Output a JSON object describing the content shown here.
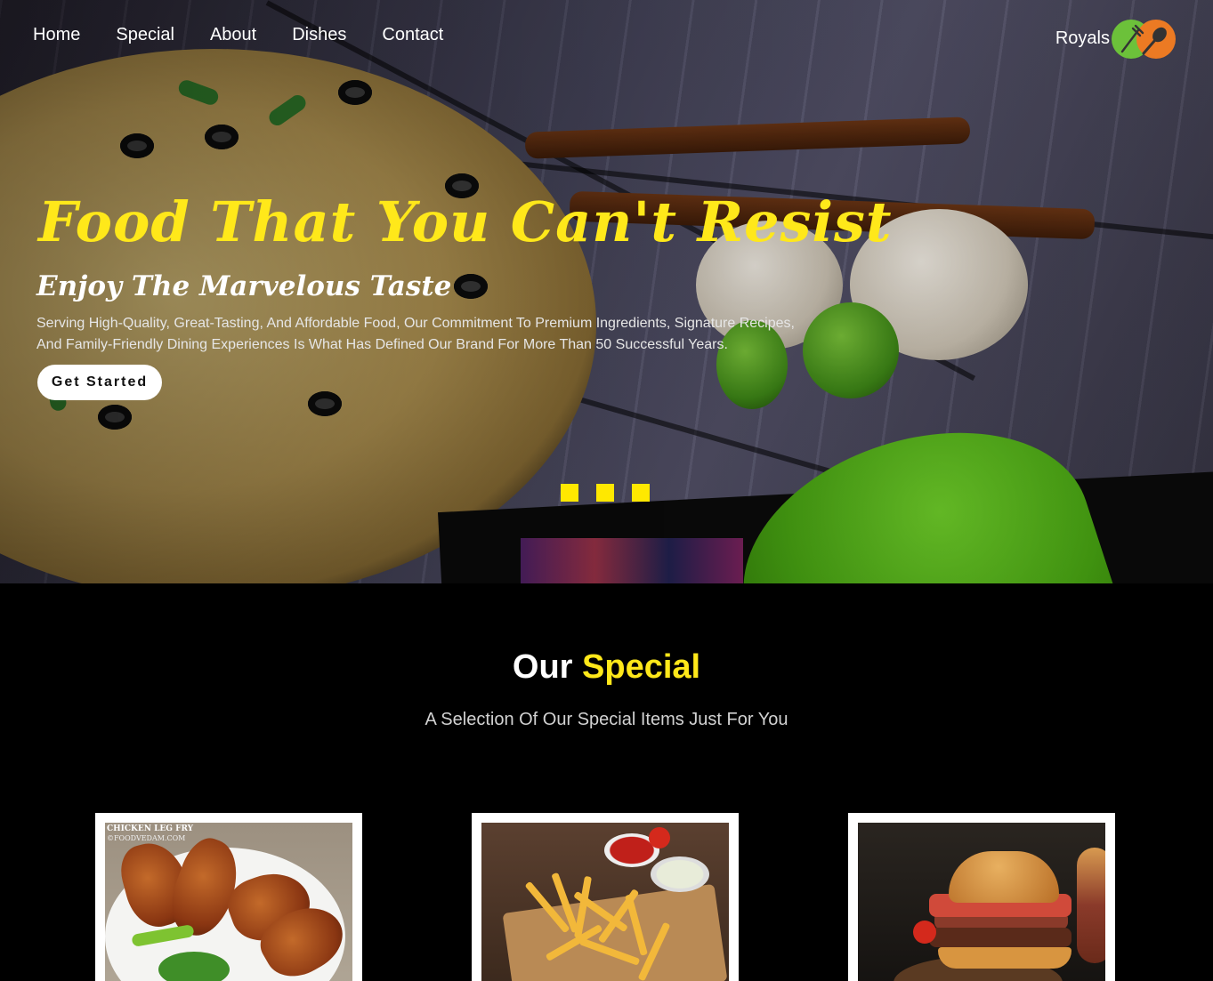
{
  "nav": {
    "items": [
      "Home",
      "Special",
      "About",
      "Dishes",
      "Contact"
    ],
    "brand": "Royals",
    "logo_icons": [
      "fork-knife-icon",
      "spoon-icon"
    ]
  },
  "hero": {
    "title": "Food That You Can't Resist",
    "subtitle": "Enjoy The Marvelous Taste",
    "description": "Serving High-Quality, Great-Tasting, And Affordable Food, Our Commitment To Premium Ingredients, Signature Recipes, And Family-Friendly Dining Experiences Is What Has Defined Our Brand For More Than 50 Successful Years.",
    "cta_label": "Get Started",
    "slide_count": 3
  },
  "special": {
    "title_part1": "Our",
    "title_part2": "Special",
    "subtitle": "A Selection Of Our Special Items Just For You",
    "cards": [
      {
        "image": "chicken-leg-fry-photo",
        "caption": "CHICKEN LEG FRY",
        "watermark": "©FOODVEDAM.COM"
      },
      {
        "image": "french-fries-photo"
      },
      {
        "image": "burger-photo"
      }
    ]
  },
  "colors": {
    "accent_yellow": "#ffe81a",
    "background": "#000000",
    "logo_green": "#6cc13a",
    "logo_orange": "#ec7a23"
  }
}
